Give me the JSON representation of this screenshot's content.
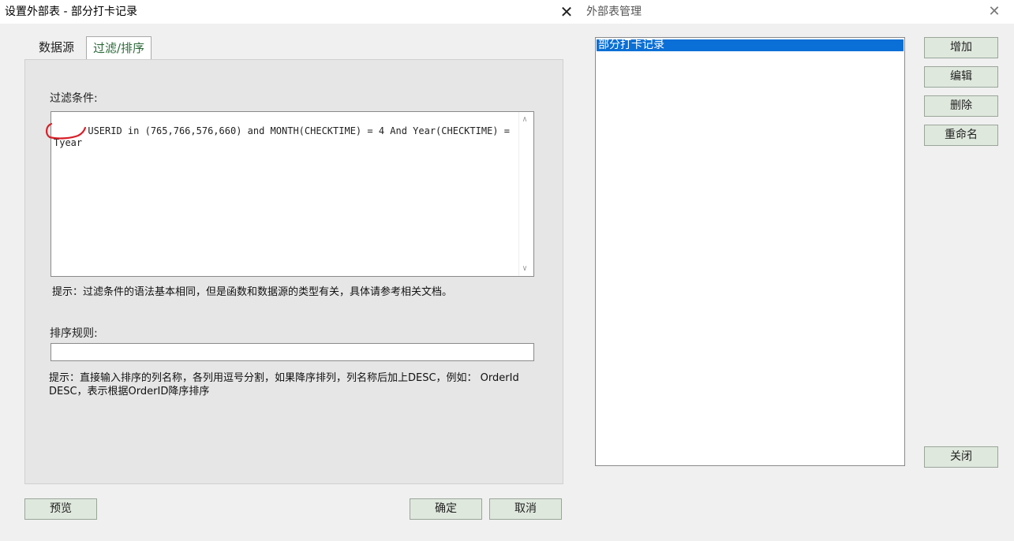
{
  "left_window": {
    "title": "设置外部表 - 部分打卡记录",
    "close_glyph": "✕",
    "tabs": [
      {
        "label": "数据源"
      },
      {
        "label": "过滤/排序"
      }
    ],
    "filter": {
      "label": "过滤条件:",
      "value": "USERID in (765,766,576,660) and MONTH(CHECKTIME) = 4 And Year(CHECKTIME) = Tyear",
      "hint": "提示：过滤条件的语法基本相同，但是函数和数据源的类型有关，具体请参考相关文档。"
    },
    "sort": {
      "label": "排序规则:",
      "value": "",
      "hint": "提示：直接输入排序的列名称，各列用逗号分割，如果降序排列，列名称后加上DESC，例如：  OrderId  DESC，表示根据OrderID降序排序"
    },
    "buttons": {
      "preview": "预览",
      "ok": "确定",
      "cancel": "取消"
    }
  },
  "right_window": {
    "title": "外部表管理",
    "close_glyph": "✕",
    "list_items": [
      "部分打卡记录"
    ],
    "selected_index": 0,
    "buttons": {
      "add": "增加",
      "edit": "编辑",
      "delete": "删除",
      "rename": "重命名",
      "close": "关闭"
    }
  },
  "colors": {
    "annotation": "#d8202a",
    "selection": "#0a6fd6",
    "button_bg": "#dfe8dd"
  },
  "icons": {
    "scroll_up": "∧",
    "scroll_down": "∨"
  }
}
